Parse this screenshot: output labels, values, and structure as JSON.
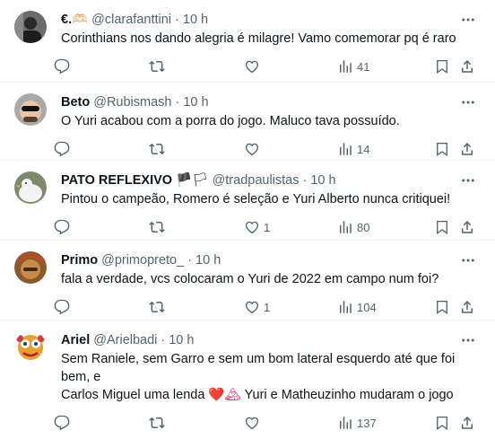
{
  "tweets": [
    {
      "name": "€.🫶🏻",
      "handle": "@clarafanttini",
      "time": "10 h",
      "text": "Corinthians nos dando alegria é milagre! Vamo comemorar pq é raro",
      "reply_count": "",
      "retweet_count": "",
      "like_count": "",
      "view_count": "41"
    },
    {
      "name": "Beto",
      "handle": "@Rubismash",
      "time": "10 h",
      "text": "O Yuri acabou com a porra do jogo. Maluco tava possuído.",
      "reply_count": "",
      "retweet_count": "",
      "like_count": "",
      "view_count": "14"
    },
    {
      "name": "PATO REFLEXIVO",
      "name_suffix": "🏴🏳",
      "handle": "@tradpaulistas",
      "time": "10 h",
      "text": "Pintou o campeão, Romero é seleção e Yuri Alberto nunca critiquei!",
      "reply_count": "",
      "retweet_count": "",
      "like_count": "1",
      "view_count": "80"
    },
    {
      "name": "Primo",
      "handle": "@primopreto_",
      "time": "10 h",
      "text": "fala a verdade, vcs colocaram o Yuri de 2022 em campo num foi?",
      "reply_count": "",
      "retweet_count": "",
      "like_count": "1",
      "view_count": "104"
    },
    {
      "name": "Ariel",
      "handle": "@Arielbadi",
      "time": "10 h",
      "text_line1": "Sem Raniele, sem Garro e sem um bom lateral esquerdo até que foi bem, e",
      "text_line2_a": "Carlos Miguel uma lenda",
      "text_line2_emoji": "❤️🏔",
      "text_line2_b": "Yuri e Matheuzinho mudaram o jogo",
      "reply_count": "",
      "retweet_count": "",
      "like_count": "",
      "view_count": "137"
    }
  ],
  "separator": "·",
  "colors": {
    "text": "#0f1419",
    "secondary": "#536471",
    "border": "#eff3f4"
  },
  "icons": [
    "reply-icon",
    "retweet-icon",
    "like-icon",
    "views-icon",
    "bookmark-icon",
    "share-icon",
    "more-icon"
  ]
}
